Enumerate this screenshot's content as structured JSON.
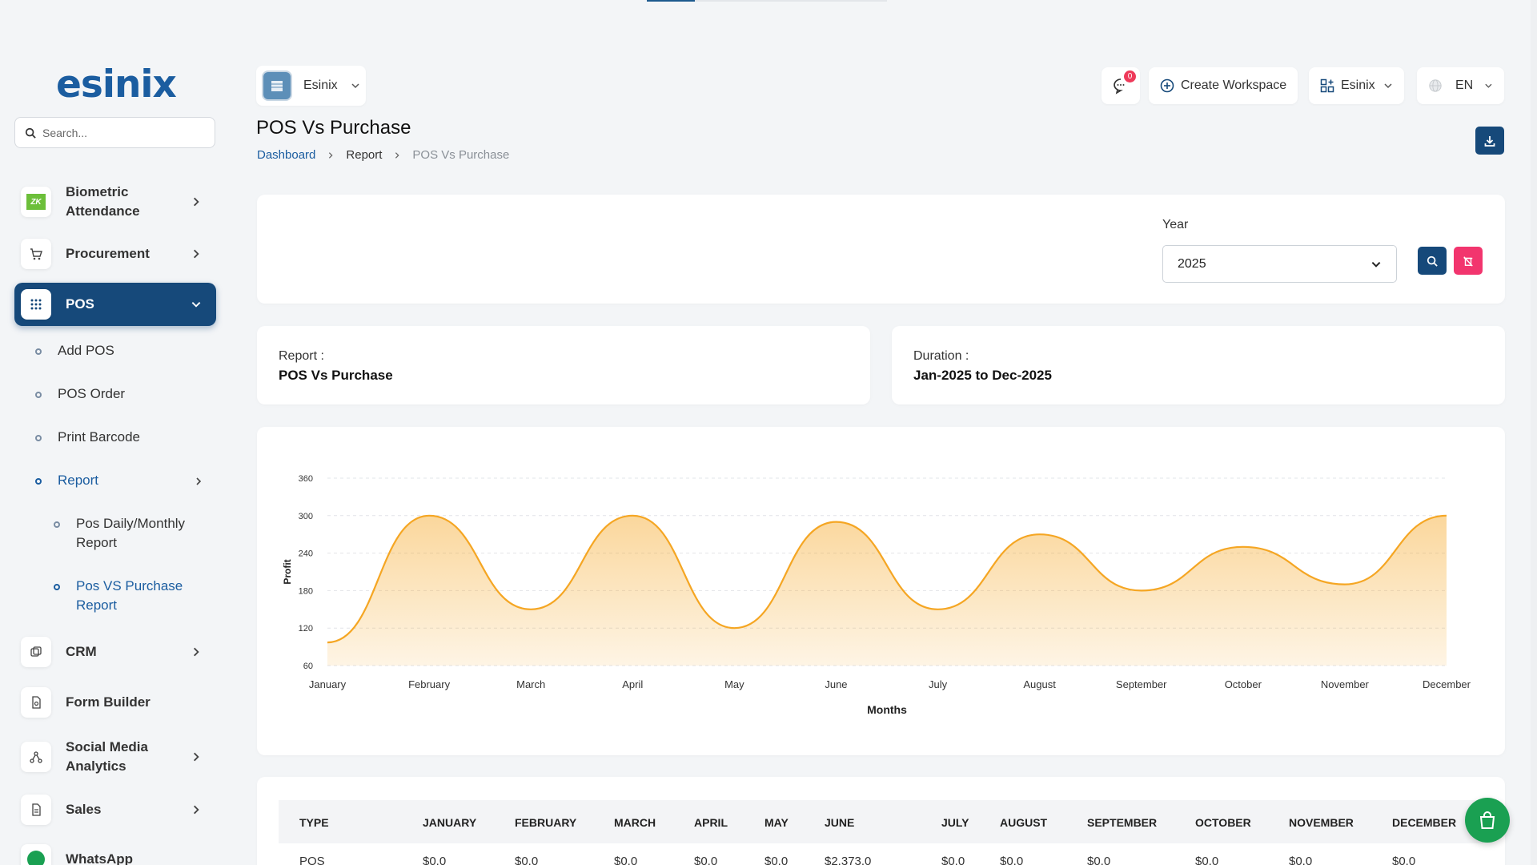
{
  "brand": {
    "logo": "esinix"
  },
  "search": {
    "placeholder": "Search..."
  },
  "sidebar": {
    "items": [
      {
        "label": "Biometric Attendance"
      },
      {
        "label": "Procurement"
      },
      {
        "label": "POS"
      },
      {
        "label": "CRM"
      },
      {
        "label": "Form Builder"
      },
      {
        "label": "Social Media Analytics"
      },
      {
        "label": "Sales"
      },
      {
        "label": "WhatsApp"
      }
    ],
    "pos_sub": [
      "Add POS",
      "POS Order",
      "Print Barcode",
      "Report"
    ],
    "report_sub": [
      "Pos Daily/Monthly Report",
      "Pos VS Purchase Report"
    ]
  },
  "header": {
    "workspace": "Esinix",
    "notification_count": "0",
    "create_workspace": "Create Workspace",
    "company": "Esinix",
    "language": "EN"
  },
  "page": {
    "title": "POS Vs Purchase",
    "breadcrumb": [
      "Dashboard",
      "Report",
      "POS Vs Purchase"
    ]
  },
  "filter": {
    "year_label": "Year",
    "year_value": "2025"
  },
  "info": {
    "report_key": "Report :",
    "report_value": "POS Vs Purchase",
    "duration_key": "Duration :",
    "duration_value": "Jan-2025 to Dec-2025"
  },
  "chart_data": {
    "type": "area",
    "categories": [
      "January",
      "February",
      "March",
      "April",
      "May",
      "June",
      "July",
      "August",
      "September",
      "October",
      "November",
      "December"
    ],
    "values": [
      97,
      300,
      150,
      300,
      120,
      290,
      150,
      270,
      180,
      250,
      190,
      300
    ],
    "xlabel": "Months",
    "ylabel": "Profit",
    "ylim": [
      60,
      360
    ],
    "yticks": [
      60,
      120,
      180,
      240,
      300,
      360
    ],
    "grid": true,
    "color": "#f5a623"
  },
  "table": {
    "headers": [
      "TYPE",
      "JANUARY",
      "FEBRUARY",
      "MARCH",
      "APRIL",
      "MAY",
      "JUNE",
      "JULY",
      "AUGUST",
      "SEPTEMBER",
      "OCTOBER",
      "NOVEMBER",
      "DECEMBER"
    ],
    "rows": [
      [
        "POS",
        "$0.0",
        "$0.0",
        "$0.0",
        "$0.0",
        "$0.0",
        "$2,373.0",
        "$0.0",
        "$0.0",
        "$0.0",
        "$0.0",
        "$0.0",
        "$0.0"
      ]
    ]
  }
}
